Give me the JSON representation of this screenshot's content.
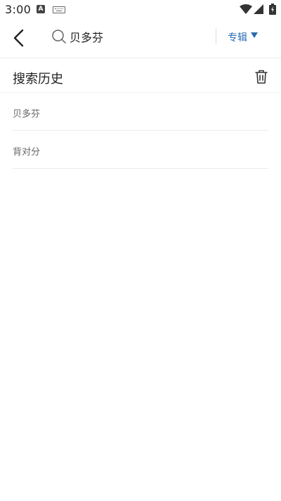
{
  "status_bar": {
    "time": "3:00",
    "a_icon_letter": "A",
    "icons": [
      "a-notification-icon",
      "keyboard-icon",
      "wifi-icon",
      "signal-icon",
      "battery-icon"
    ]
  },
  "search": {
    "back_icon": "back-arrow-icon",
    "search_icon": "search-icon",
    "query": "贝多芬",
    "category": "专辑",
    "category_icon": "caret-down-icon",
    "accent_color": "#2b6cb0"
  },
  "history": {
    "title": "搜索历史",
    "clear_icon": "trash-icon",
    "items": [
      {
        "label": "贝多芬"
      },
      {
        "label": "背对分"
      }
    ]
  }
}
